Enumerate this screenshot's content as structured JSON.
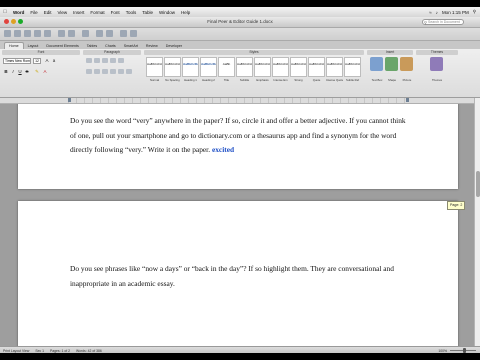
{
  "menubar": {
    "items": [
      {
        "label": "Word"
      },
      {
        "label": "File"
      },
      {
        "label": "Edit"
      },
      {
        "label": "View"
      },
      {
        "label": "Insert"
      },
      {
        "label": "Format"
      },
      {
        "label": "Font"
      },
      {
        "label": "Tools"
      },
      {
        "label": "Table"
      },
      {
        "label": "Window"
      },
      {
        "label": "Help"
      }
    ],
    "clock": "Mon 1:15 PM"
  },
  "window": {
    "title": "Final Peer & Editor Guide 1.docx"
  },
  "search": {
    "placeholder": "Search in Document"
  },
  "ribbon": {
    "tabs": [
      {
        "label": "Home"
      },
      {
        "label": "Layout"
      },
      {
        "label": "Document Elements"
      },
      {
        "label": "Tables"
      },
      {
        "label": "Charts"
      },
      {
        "label": "SmartArt"
      },
      {
        "label": "Review"
      },
      {
        "label": "Developer"
      }
    ],
    "group_font": "Font",
    "group_paragraph": "Paragraph",
    "group_styles": "Styles",
    "group_insert": "Insert",
    "group_themes": "Themes",
    "font_name": "Times New Roman (Body)",
    "font_size": "12",
    "styles": [
      {
        "sample": "AaBbCcDdEe",
        "name": "Normal"
      },
      {
        "sample": "AaBbCcDdEe",
        "name": "No Spacing"
      },
      {
        "sample": "AaBbCcDc",
        "name": "Heading 1"
      },
      {
        "sample": "AaBbCcDdEe",
        "name": "Heading 2"
      },
      {
        "sample": "AaBb",
        "name": "Title"
      },
      {
        "sample": "AaBbCcDdEe",
        "name": "Subtitle"
      },
      {
        "sample": "AaBbCcDdEe",
        "name": "Emphasis"
      },
      {
        "sample": "AaBbCcDdEe",
        "name": "Intense Em"
      },
      {
        "sample": "AaBbCcDdEe",
        "name": "Strong"
      },
      {
        "sample": "AaBbCcDdEe",
        "name": "Quote"
      },
      {
        "sample": "AaBbCcDdEe",
        "name": "Intense Quote"
      },
      {
        "sample": "AaBbCcDdEe",
        "name": "Subtle Ref"
      }
    ],
    "insert_label": "Text Box",
    "shape_label": "Shape",
    "picture_label": "Picture",
    "themes_label": "Themes"
  },
  "document": {
    "para1": "Do you see the word “very” anywhere in the paper? If so, circle it and offer a better adjective. If you cannot think of one, pull out your smartphone and go to dictionary.com or a thesaurus app and find a synonym for the word directly following “very.” Write it on the paper. ",
    "para1_highlight": "excited",
    "para2": "Do you see phrases like “now a days” or “back in the day”? If so highlight them. They are conversational and inappropriate in an academic essay."
  },
  "scroll_tooltip": "Page: 2",
  "statusbar": {
    "view": "Print Layout View",
    "sec": "Sec 1",
    "pages": "Pages: 1 of 2",
    "words": "Words: 42 of 386",
    "zoom": "100%"
  },
  "colors": {
    "highlight_text": "#1e4fc6",
    "menubar": "#e6e6e6"
  }
}
